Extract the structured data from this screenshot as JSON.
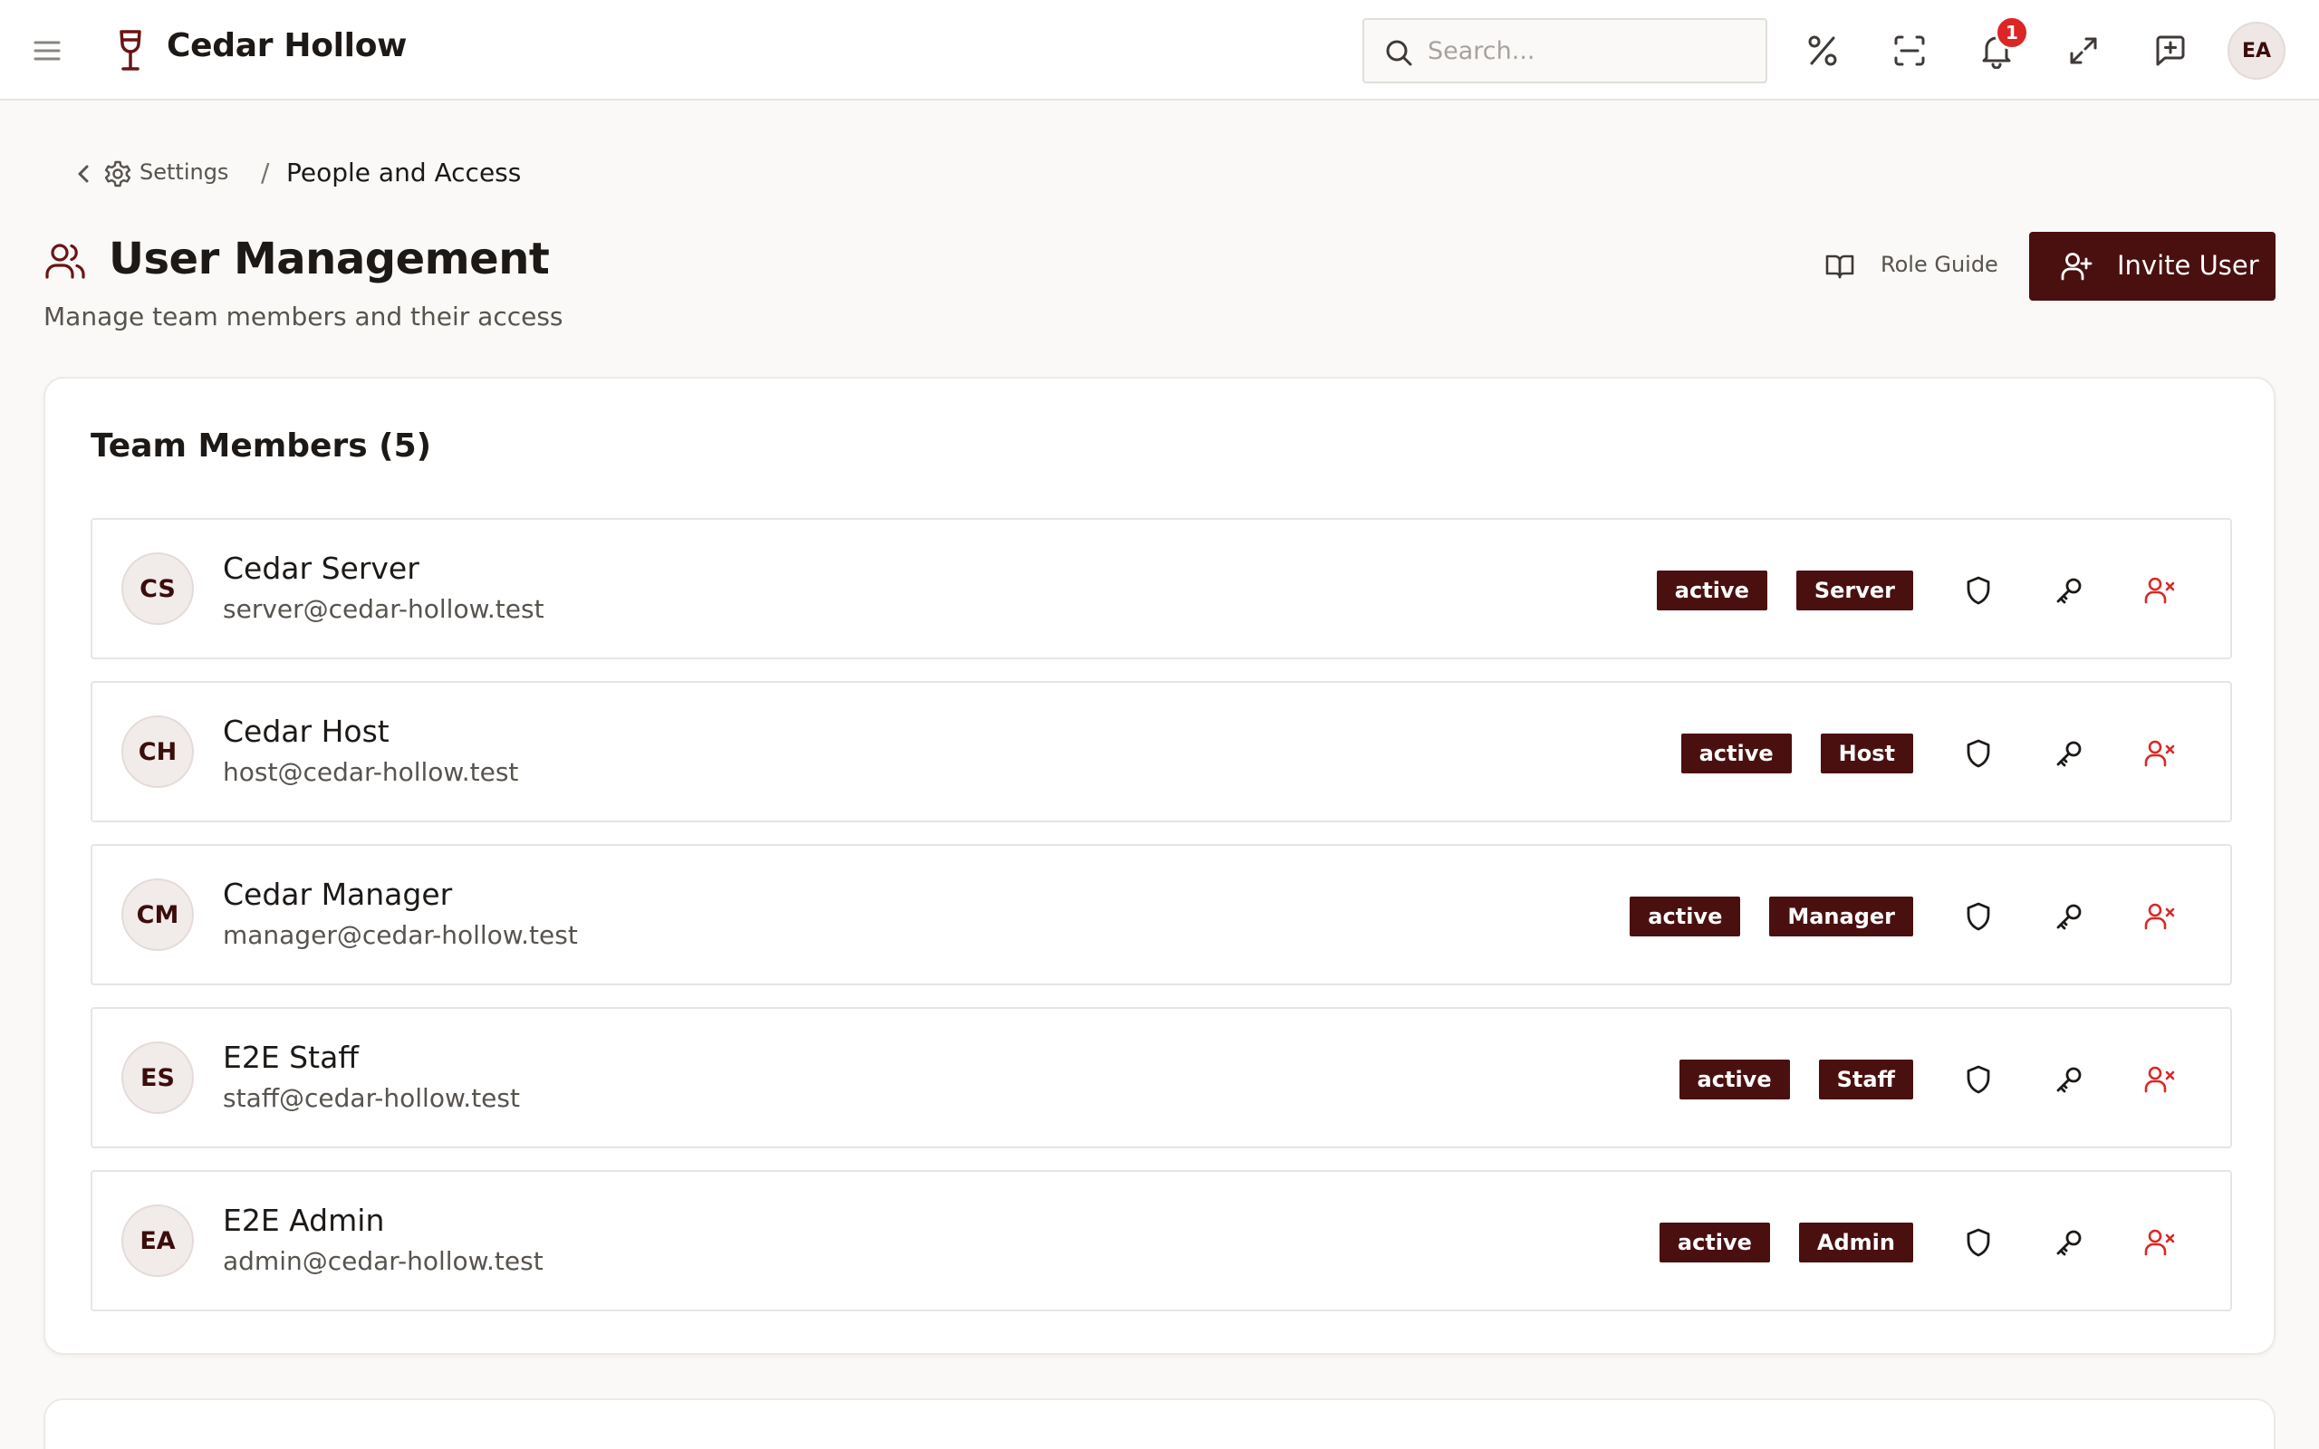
{
  "app": {
    "brand": "Cedar Hollow",
    "search_placeholder": "Search...",
    "notification_count": "1",
    "user_initials": "EA"
  },
  "breadcrumb": {
    "parent": "Settings",
    "separator": "/",
    "current": "People and Access"
  },
  "header": {
    "title": "User Management",
    "subtitle": "Manage team members and their access",
    "role_guide_label": "Role Guide",
    "invite_label": "Invite User"
  },
  "team": {
    "title": "Team Members (5)",
    "members": [
      {
        "initials": "CS",
        "name": "Cedar Server",
        "email": "server@cedar-hollow.test",
        "status": "active",
        "role": "Server"
      },
      {
        "initials": "CH",
        "name": "Cedar Host",
        "email": "host@cedar-hollow.test",
        "status": "active",
        "role": "Host"
      },
      {
        "initials": "CM",
        "name": "Cedar Manager",
        "email": "manager@cedar-hollow.test",
        "status": "active",
        "role": "Manager"
      },
      {
        "initials": "ES",
        "name": "E2E Staff",
        "email": "staff@cedar-hollow.test",
        "status": "active",
        "role": "Staff"
      },
      {
        "initials": "EA",
        "name": "E2E Admin",
        "email": "admin@cedar-hollow.test",
        "status": "active",
        "role": "Admin"
      }
    ]
  },
  "colors": {
    "brand_dark": "#4a1010",
    "danger": "#dc2626",
    "background": "#faf9f7"
  },
  "icons": {
    "menu": "menu-icon",
    "logo": "wine-glass-icon",
    "search": "search-icon",
    "percent": "percent-icon",
    "scan": "scan-icon",
    "bell": "bell-icon",
    "expand": "expand-icon",
    "feedback": "message-plus-icon",
    "row_shield": "shield-icon",
    "row_key": "key-icon",
    "row_remove": "user-x-icon"
  }
}
